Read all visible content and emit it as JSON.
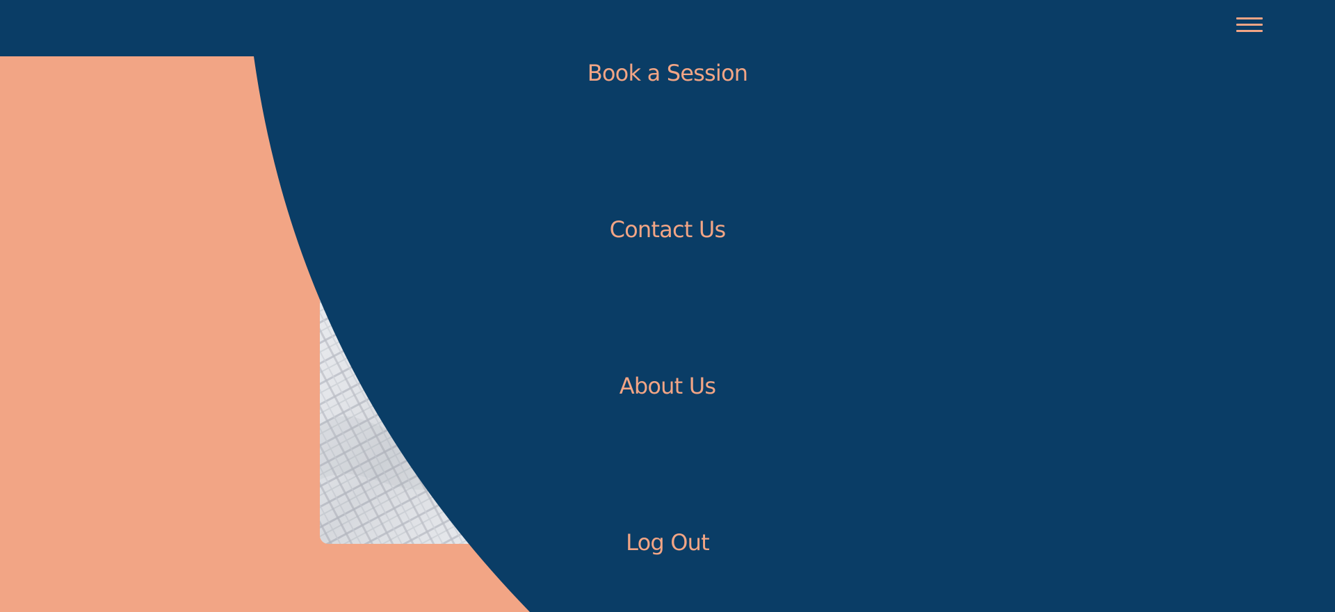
{
  "header": {
    "menu_icon": "hamburger-menu-icon"
  },
  "navigation": {
    "items": [
      {
        "label": "Book a Session"
      },
      {
        "label": "Contact Us"
      },
      {
        "label": "About Us"
      },
      {
        "label": "Log Out"
      }
    ]
  },
  "theme": {
    "navy": "#0a3d66",
    "peach": "#f2a585",
    "fabric_light": "#e6e8ec",
    "fabric_grid": "#b9bdc5"
  }
}
